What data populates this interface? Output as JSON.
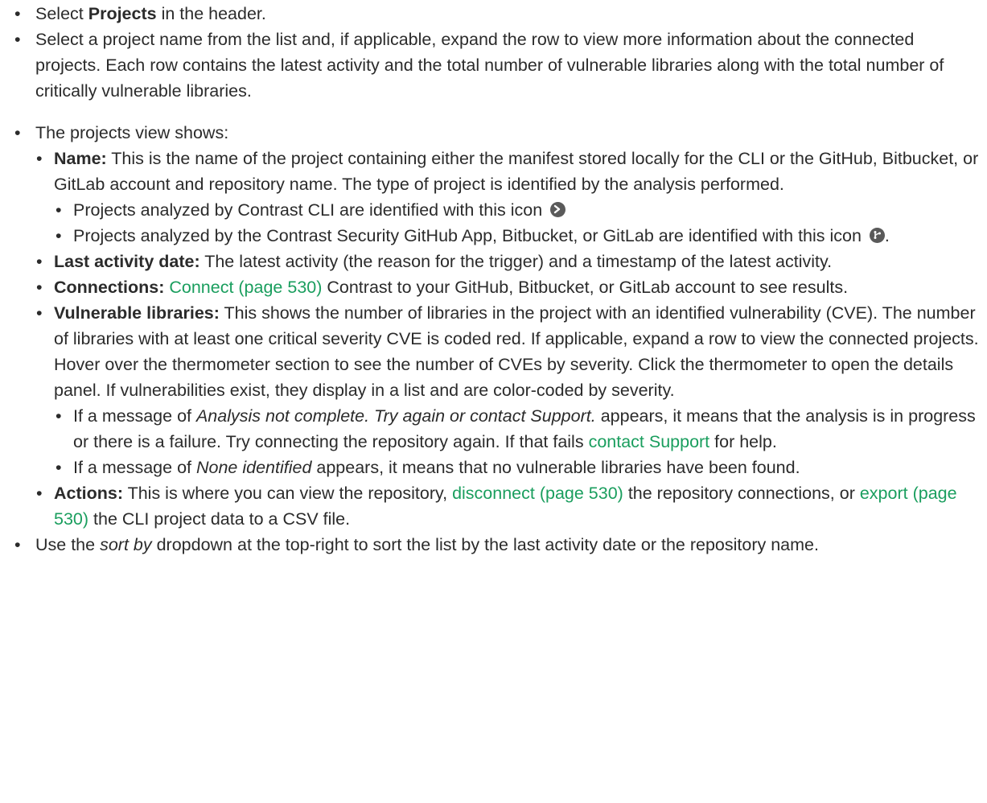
{
  "items": {
    "select_projects": {
      "pre": "Select ",
      "bold": "Projects",
      "post": " in the header."
    },
    "select_name": "Select a project name from the list and, if applicable, expand the row to view more information about the connected projects. Each row contains the latest activity and the total number of vulnerable libraries along with the total number of critically vulnerable libraries.",
    "view_shows": "The projects view shows:",
    "name": {
      "label": "Name:",
      "text": " This is the name of the project containing either the manifest stored locally for the CLI or the GitHub, Bitbucket, or GitLab account and repository name. The type of project is identified by the analysis performed.",
      "cli": "Projects analyzed by Contrast CLI are identified with this icon ",
      "cli_icon": "terminal-icon",
      "app": "Projects analyzed by the Contrast Security GitHub App, Bitbucket, or GitLab are identified with this icon ",
      "app_icon": "branch-icon",
      "app_end": "."
    },
    "last_activity": {
      "label": "Last activity date:",
      "text": " The latest activity (the reason for the trigger) and a timestamp of the latest activity."
    },
    "connections": {
      "label": "Connections:",
      "link": "Connect (page 530)",
      "text": " Contrast to your GitHub, Bitbucket, or GitLab account to see results."
    },
    "vulnerable": {
      "label": "Vulnerable libraries:",
      "text": " This shows the number of libraries in the project with an identified vulnerability (CVE). The number of libraries with at least one critical severity CVE is coded red. If applicable, expand a row to view the connected projects. Hover over the thermometer section to see the number of CVEs by severity. Click the thermometer to open the details panel. If vulnerabilities exist, they display in a list and are color-coded by severity.",
      "msg1_pre": "If a message of ",
      "msg1_italic": "Analysis not complete. Try again or contact Support.",
      "msg1_post": " appears, it means that the analysis is in progress or there is a failure. Try connecting the repository again. If that fails ",
      "msg1_link": "contact Support",
      "msg1_end": " for help.",
      "msg2_pre": "If a message of ",
      "msg2_italic": "None identified",
      "msg2_post": " appears, it means that no vulnerable libraries have been found."
    },
    "actions": {
      "label": "Actions:",
      "text1": " This is where you can view the repository, ",
      "link1": "disconnect (page 530)",
      "text2": " the repository connections, or ",
      "link2": "export (page 530)",
      "text3": " the CLI project data to a CSV file."
    },
    "sort": {
      "pre": "Use the ",
      "italic": "sort by",
      "post": " dropdown at the top-right to sort the list by the last activity date or the repository name."
    }
  },
  "colors": {
    "text": "#2b2b2b",
    "link": "#1a9e5e",
    "icon": "#5a5a5a"
  }
}
